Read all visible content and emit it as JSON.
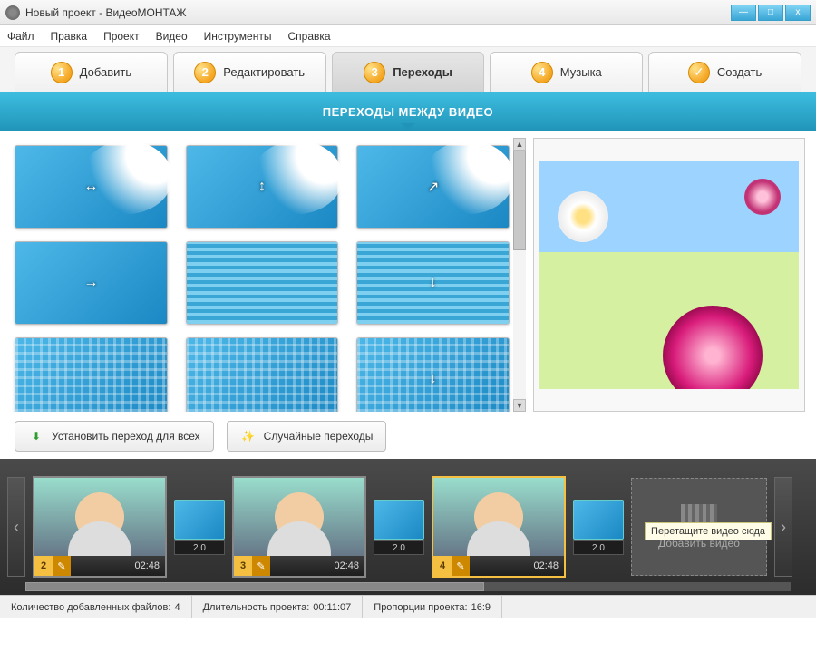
{
  "window": {
    "title": "Новый проект - ВидеоМОНТАЖ"
  },
  "menu": [
    "Файл",
    "Правка",
    "Проект",
    "Видео",
    "Инструменты",
    "Справка"
  ],
  "steps": [
    {
      "num": "1",
      "label": "Добавить"
    },
    {
      "num": "2",
      "label": "Редактировать"
    },
    {
      "num": "3",
      "label": "Переходы",
      "active": true
    },
    {
      "num": "4",
      "label": "Музыка"
    },
    {
      "num": "✓",
      "label": "Создать",
      "check": true
    }
  ],
  "banner": "ПЕРЕХОДЫ МЕЖДУ ВИДЕО",
  "buttons": {
    "apply_all": "Установить переход для всех",
    "random": "Случайные переходы"
  },
  "timeline": {
    "clips": [
      {
        "num": "2",
        "time": "02:48"
      },
      {
        "num": "3",
        "time": "02:48"
      },
      {
        "num": "4",
        "time": "02:48",
        "selected": true
      }
    ],
    "transition_duration": "2.0",
    "dropzone_tip": "Перетащите видео сюда",
    "dropzone_label": "Добавить видео"
  },
  "status": {
    "files_label": "Количество добавленных файлов:",
    "files_value": "4",
    "duration_label": "Длительность проекта:",
    "duration_value": "00:11:07",
    "aspect_label": "Пропорции проекта:",
    "aspect_value": "16:9"
  },
  "winbtns": {
    "min": "—",
    "max": "□",
    "close": "x"
  }
}
